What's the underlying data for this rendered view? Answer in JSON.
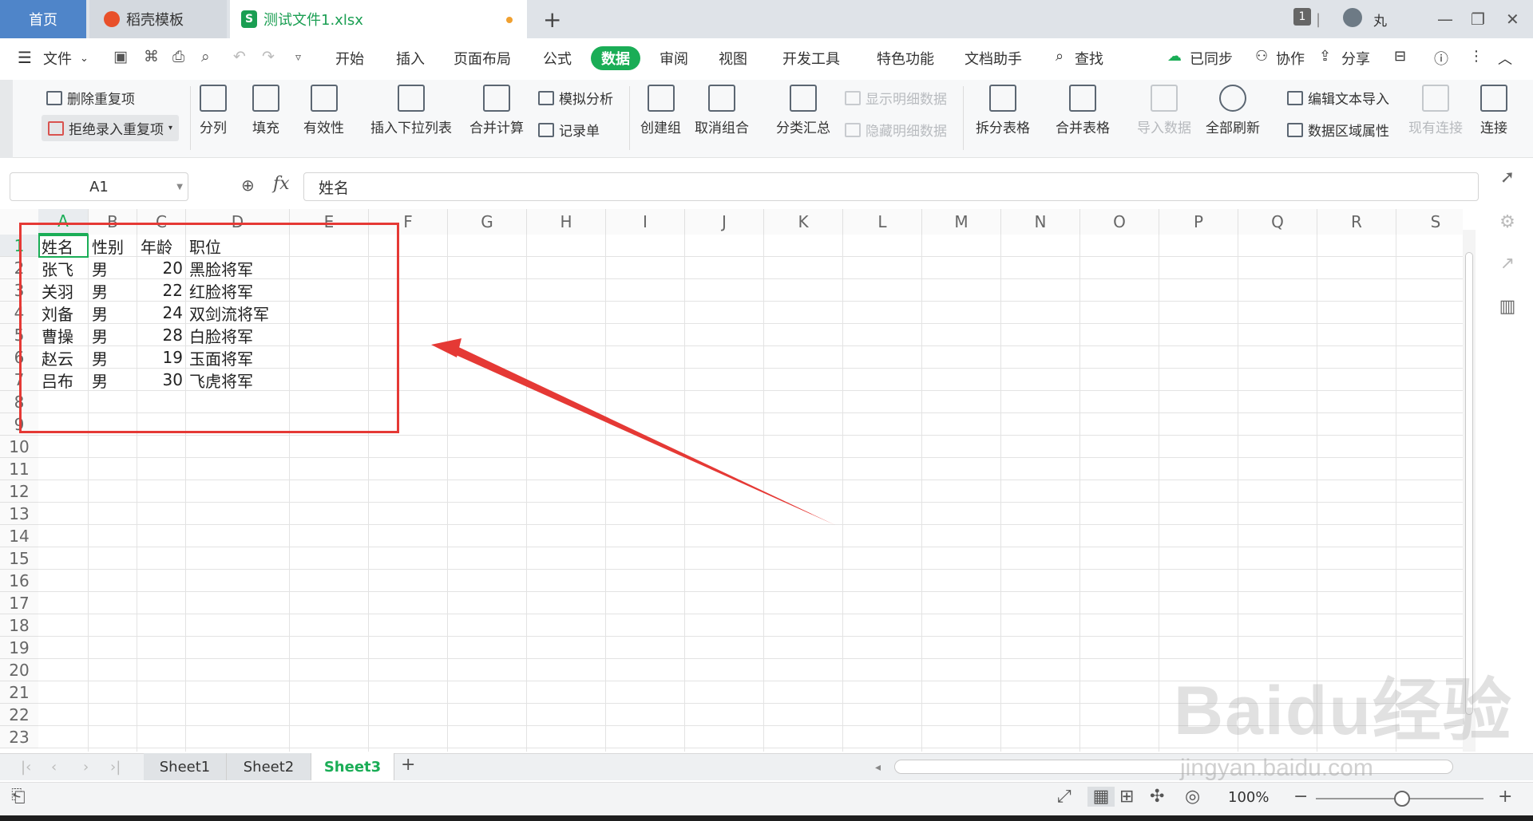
{
  "tabs": {
    "home": "首页",
    "template": "稻壳模板",
    "file": "测试文件1.xlsx",
    "file_icon": "S",
    "daoke_icon": "D"
  },
  "titlebar": {
    "badge": "1",
    "user": "丸"
  },
  "menu": {
    "file": "文件",
    "items": [
      "开始",
      "插入",
      "页面布局",
      "公式",
      "数据",
      "审阅",
      "视图",
      "开发工具",
      "特色功能",
      "文档助手"
    ],
    "active": "数据",
    "search": "查找",
    "sync": "已同步",
    "collab": "协作",
    "share": "分享"
  },
  "ribbon": {
    "delete_dup": "删除重复项",
    "reject_dup": "拒绝录入重复项",
    "split_col": "分列",
    "fill": "填充",
    "validity": "有效性",
    "insert_dropdown": "插入下拉列表",
    "consolidate": "合并计算",
    "what_if": "模拟分析",
    "record": "记录单",
    "create_group": "创建组",
    "ungroup": "取消组合",
    "subtotal": "分类汇总",
    "show_detail": "显示明细数据",
    "hide_detail": "隐藏明细数据",
    "split_table": "拆分表格",
    "merge_table": "合并表格",
    "import_data": "导入数据",
    "refresh_all": "全部刷新",
    "edit_text_import": "编辑文本导入",
    "range_props": "数据区域属性",
    "existing_conn": "现有连接",
    "connect": "连接"
  },
  "formula_bar": {
    "cell_ref": "A1",
    "fx": "fx",
    "content": "姓名"
  },
  "columns": [
    "A",
    "B",
    "C",
    "D",
    "E",
    "F",
    "G",
    "H",
    "I",
    "J",
    "K",
    "L",
    "M",
    "N",
    "O",
    "P",
    "Q",
    "R",
    "S"
  ],
  "rows": [
    "1",
    "2",
    "3",
    "4",
    "5",
    "6",
    "7",
    "8",
    "9",
    "10",
    "11",
    "12",
    "13",
    "14",
    "15",
    "16",
    "17",
    "18",
    "19",
    "20",
    "21",
    "22",
    "23"
  ],
  "table": {
    "header": [
      "姓名",
      "性别",
      "年龄",
      "职位"
    ],
    "data": [
      [
        "张飞",
        "男",
        "20",
        "黑脸将军"
      ],
      [
        "关羽",
        "男",
        "22",
        "红脸将军"
      ],
      [
        "刘备",
        "男",
        "24",
        "双剑流将军"
      ],
      [
        "曹操",
        "男",
        "28",
        "白脸将军"
      ],
      [
        "赵云",
        "男",
        "19",
        "玉面将军"
      ],
      [
        "吕布",
        "男",
        "30",
        "飞虎将军"
      ]
    ]
  },
  "sheets": [
    "Sheet1",
    "Sheet2",
    "Sheet3"
  ],
  "active_sheet": "Sheet3",
  "status": {
    "zoom": "100%"
  },
  "watermark": {
    "brand": "Baidu经验",
    "url": "jingyan.baidu.com"
  },
  "colors": {
    "accent_green": "#1aad56",
    "home_tab_blue": "#4f85c9",
    "annotation_red": "#e53935"
  }
}
